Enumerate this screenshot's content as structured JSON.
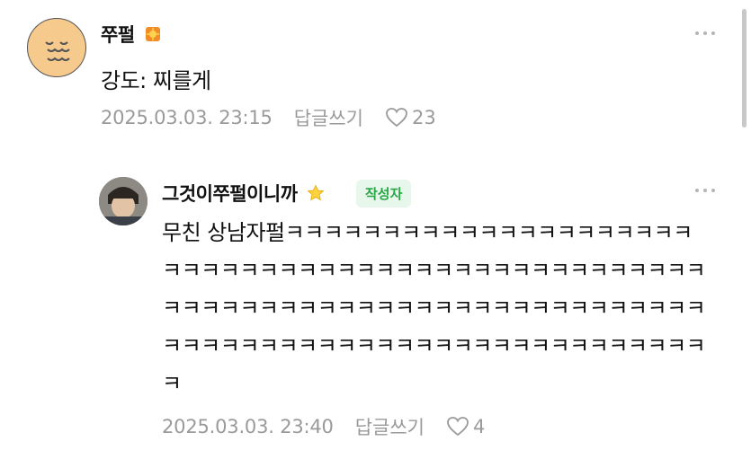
{
  "comments": [
    {
      "author": "쭈펄",
      "badge_icon": "sun-badge-icon",
      "text": "강도: 찌를게",
      "date": "2025.03.03. 23:15",
      "reply_label": "답글쓰기",
      "likes": "23"
    }
  ],
  "replies": [
    {
      "author": "그것이쭈펄이니까",
      "badge_icon": "star-badge-icon",
      "author_badge": "작성자",
      "text": "무친 상남자펄ㅋㅋㅋㅋㅋㅋㅋㅋㅋㅋㅋㅋㅋㅋㅋㅋㅋㅋㅋㅋㅋㅋㅋㅋㅋㅋㅋㅋㅋㅋㅋㅋㅋㅋㅋㅋㅋㅋㅋㅋㅋㅋㅋㅋㅋㅋㅋㅋㅋㅋㅋㅋㅋㅋㅋㅋㅋㅋㅋㅋㅋㅋㅋㅋㅋㅋㅋㅋㅋㅋㅋㅋㅋㅋㅋㅋㅋㅋㅋㅋㅋㅋㅋㅋㅋㅋㅋㅋㅋㅋㅋㅋㅋㅋㅋㅋㅋㅋㅋㅋㅋㅋㅋㅋㅋㅋ",
      "date": "2025.03.03. 23:40",
      "reply_label": "답글쓰기",
      "likes": "4"
    }
  ],
  "colors": {
    "author_badge_bg": "#e8f7ec",
    "author_badge_text": "#27a844",
    "meta_text": "#9a9a9a"
  }
}
